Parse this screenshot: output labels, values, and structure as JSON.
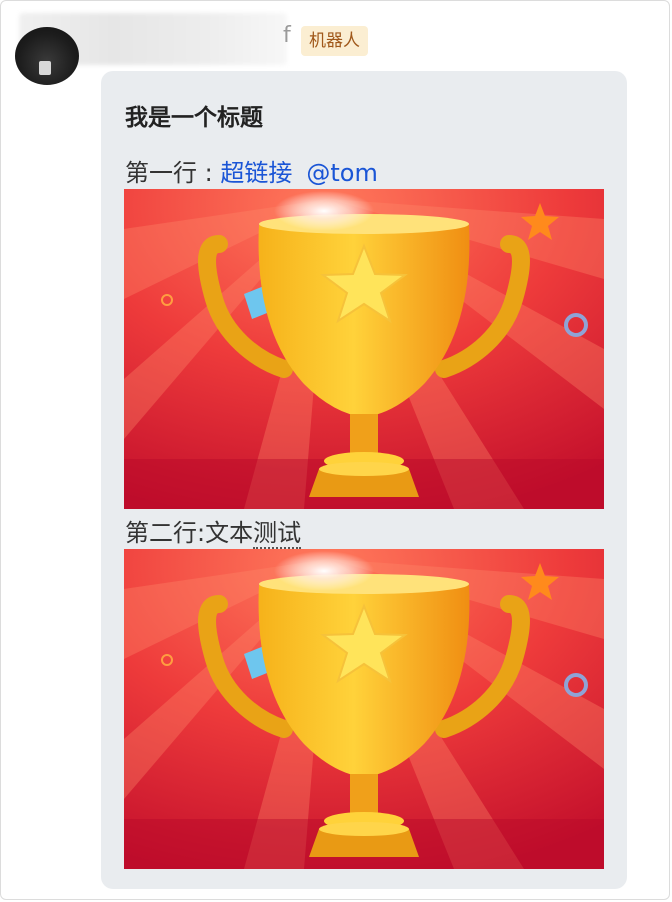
{
  "sender": {
    "name_suffix": "f",
    "badge": "机器人"
  },
  "message": {
    "title": "我是一个标题",
    "line1": {
      "prefix": "第一行 : ",
      "link": "超链接",
      "mention": "@tom"
    },
    "line2": {
      "prefix": "第二行:文本",
      "underlined": "测试"
    },
    "images": [
      {
        "icon": "trophy-icon"
      },
      {
        "icon": "trophy-icon"
      }
    ]
  },
  "colors": {
    "bubble_bg": "#e9ecef",
    "link": "#1a55d6",
    "badge_bg": "#fbeed2",
    "badge_text": "#a0581a"
  }
}
